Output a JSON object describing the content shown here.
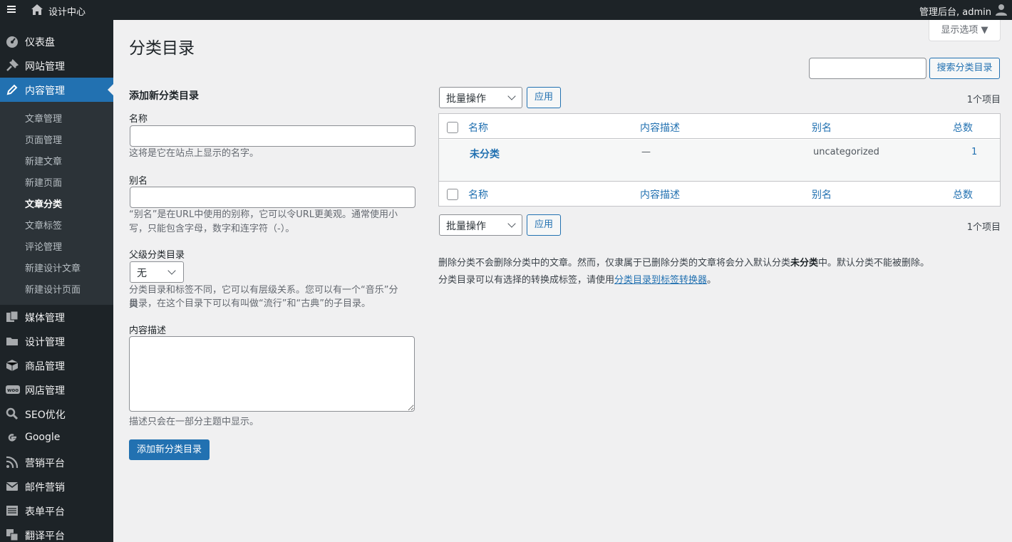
{
  "adminbar": {
    "site_name": "设计中心",
    "account": "管理后台, admin"
  },
  "sidebar": {
    "items": [
      {
        "label": "仪表盘"
      },
      {
        "label": "网站管理"
      },
      {
        "label": "内容管理"
      },
      {
        "label": "媒体管理"
      },
      {
        "label": "设计管理"
      },
      {
        "label": "商品管理"
      },
      {
        "label": "网店管理"
      },
      {
        "label": "SEO优化"
      },
      {
        "label": "Google"
      },
      {
        "label": "营销平台"
      },
      {
        "label": "邮件营销"
      },
      {
        "label": "表单平台"
      },
      {
        "label": "翻译平台"
      }
    ],
    "submenu": [
      {
        "label": "文章管理"
      },
      {
        "label": "页面管理"
      },
      {
        "label": "新建文章"
      },
      {
        "label": "新建页面"
      },
      {
        "label": "文章分类"
      },
      {
        "label": "文章标签"
      },
      {
        "label": "评论管理"
      },
      {
        "label": "新建设计文章"
      },
      {
        "label": "新建设计页面"
      }
    ],
    "woo_badge": "woo"
  },
  "header": {
    "title": "分类目录",
    "screen_options": "显示选项 ▼"
  },
  "search": {
    "placeholder": "",
    "button": "搜索分类目录"
  },
  "form": {
    "heading": "添加新分类目录",
    "name_label": "名称",
    "name_help": "这将是它在站点上显示的名字。",
    "slug_label": "别名",
    "slug_help_1": "“别名”是在URL中使用的别称，它可以令URL更美观。通常使用小",
    "slug_help_2": "写，只能包含字母，数字和连字符（-）。",
    "parent_label": "父级分类目录",
    "parent_value": "无",
    "parent_help_1": "分类目录和标签不同，它可以有层级关系。您可以有一个“音乐”分类",
    "parent_help_2": "目录，在这个目录下可以有叫做“流行”和“古典”的子目录。",
    "desc_label": "内容描述",
    "desc_help": "描述只会在一部分主题中显示。",
    "submit": "添加新分类目录"
  },
  "table": {
    "bulk_action": "批量操作",
    "apply": "应用",
    "count_text": "1个项目",
    "columns": [
      "名称",
      "内容描述",
      "别名",
      "总数"
    ],
    "rows": [
      {
        "name": "未分类",
        "description": "—",
        "slug": "uncategorized",
        "count": "1"
      }
    ]
  },
  "notes": {
    "line1_a": "删除分类不会删除分类中的文章。然而，仅隶属于已删除分类的文章将会分入默认分类",
    "line1_bold": "未分类",
    "line1_b": "中。默认分类不能被删除。",
    "line2_a": "分类目录可以有选择的转换成标签，请使用",
    "line2_link": "分类目录到标签转换器",
    "line2_b": "。"
  }
}
